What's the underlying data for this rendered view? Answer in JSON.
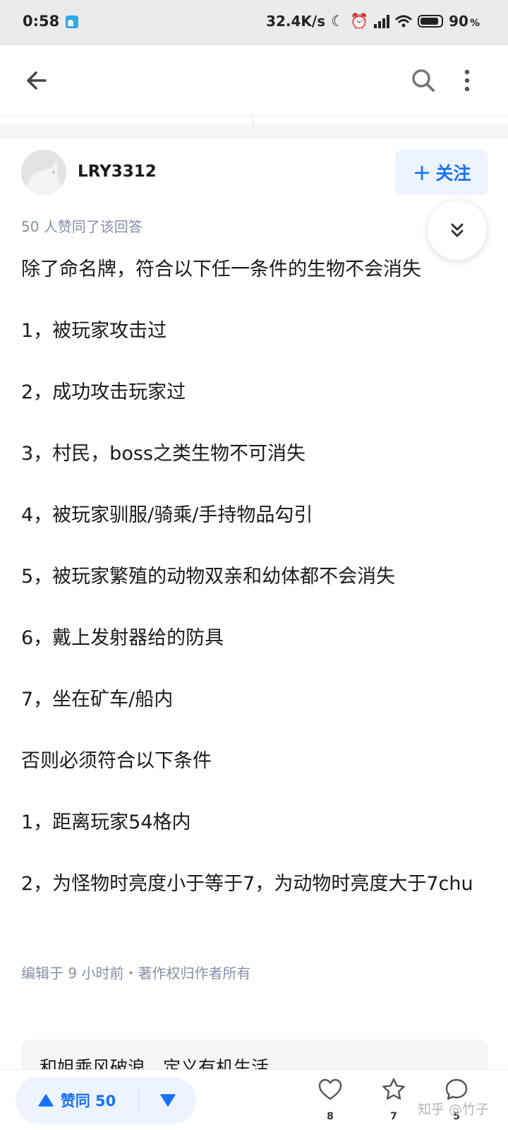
{
  "status_bar": {
    "time": "0:58",
    "net_speed": "32.4K/s",
    "battery": "90",
    "battery_unit": "%",
    "battery_level": 0.9
  },
  "header": {
    "icons": [
      "back-icon",
      "search-icon",
      "more-icon"
    ]
  },
  "answer": {
    "author": "LRY3312",
    "follow_label": "关注",
    "vote_summary": "50 人赞同了该回答",
    "paragraphs": [
      "除了命名牌，符合以下任一条件的生物不会消失",
      "1，被玩家攻击过",
      "2，成功攻击玩家过",
      "3，村民，boss之类生物不可消失",
      "4，被玩家驯服/骑乘/手持物品勾引",
      "5，被玩家繁殖的动物双亲和幼体都不会消失",
      "6，戴上发射器给的防具",
      "7，坐在矿车/船内",
      "否则必须符合以下条件",
      "1，距离玩家54格内",
      "2，为怪物时亮度小于等于7，为动物时亮度大于7chu"
    ],
    "edit_meta": "编辑于 9 小时前・著作权归作者所有"
  },
  "ad_card": {
    "title": "和姐乘风破浪，定义有机生活"
  },
  "bottom_bar": {
    "upvote_label": "赞同 50",
    "like_count": "8",
    "favorite_count": "7",
    "comment_count": "5"
  },
  "watermark": "知乎 @竹子",
  "colors": {
    "accent": "#1772f6",
    "accent_bg": "#eef4ff",
    "meta_text": "#8590a6",
    "status_bar_bg": "#ebebeb"
  }
}
